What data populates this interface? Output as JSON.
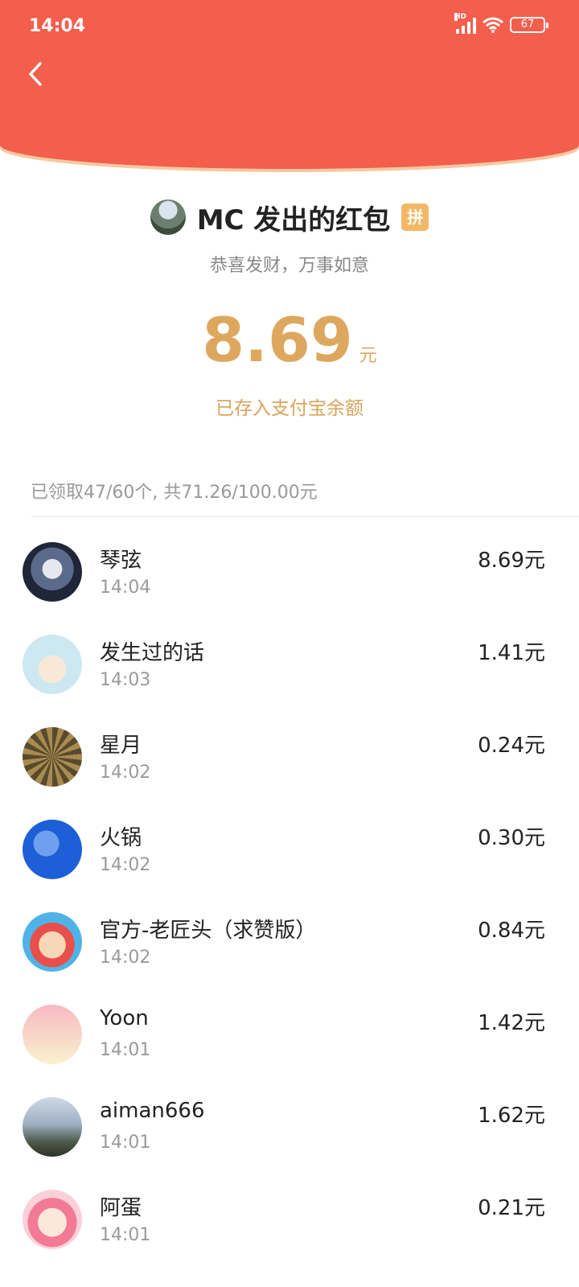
{
  "status_bar": {
    "time": "14:04",
    "network": "HD",
    "battery": "67"
  },
  "header": {
    "back_icon": "chevron-left-icon"
  },
  "envelope": {
    "title": "MC 发出的红包",
    "badge": "拼",
    "greeting": "恭喜发财，万事如意",
    "amount": "8.69",
    "unit": "元",
    "saved_text": "已存入支付宝余额"
  },
  "summary": "已领取47/60个, 共71.26/100.00元",
  "receivers": [
    {
      "name": "琴弦",
      "time": "14:04",
      "amount": "8.69元"
    },
    {
      "name": "发生过的话",
      "time": "14:03",
      "amount": "1.41元"
    },
    {
      "name": "星月",
      "time": "14:02",
      "amount": "0.24元"
    },
    {
      "name": "火锅",
      "time": "14:02",
      "amount": "0.30元"
    },
    {
      "name": "官方-老匠头（求赞版）",
      "time": "14:02",
      "amount": "0.84元"
    },
    {
      "name": "Yoon",
      "time": "14:01",
      "amount": "1.42元"
    },
    {
      "name": "aiman666",
      "time": "14:01",
      "amount": "1.62元"
    },
    {
      "name": "阿蛋",
      "time": "14:01",
      "amount": "0.21元"
    }
  ],
  "colors": {
    "header_red": "#f45e4c",
    "gold": "#dda85e",
    "badge": "#f3b866"
  }
}
